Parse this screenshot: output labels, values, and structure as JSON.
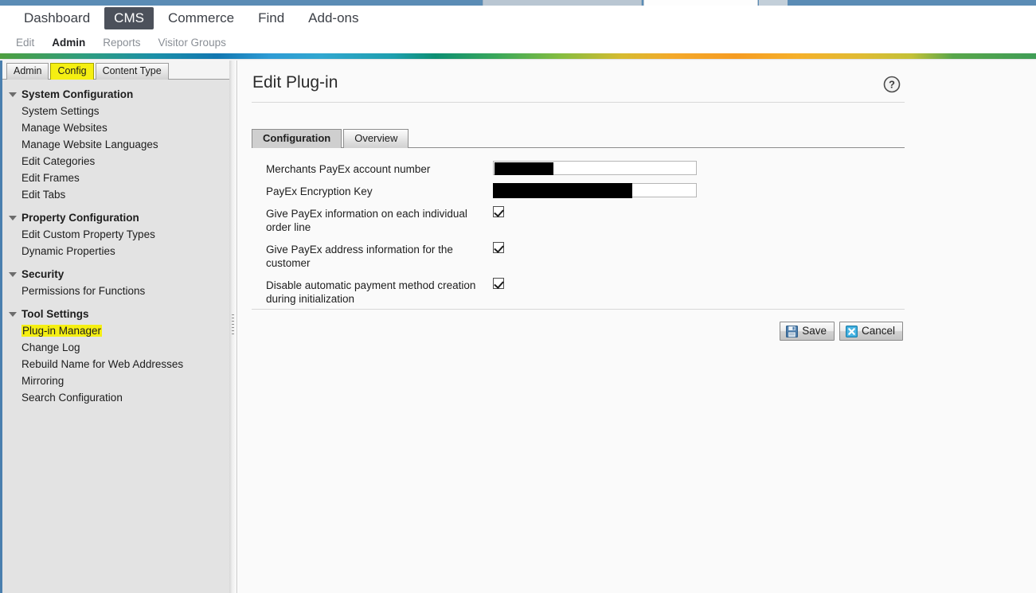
{
  "browser": {
    "tab_label": "",
    "note": ""
  },
  "topnav": {
    "items": [
      {
        "label": "Dashboard",
        "active": false
      },
      {
        "label": "CMS",
        "active": true
      },
      {
        "label": "Commerce",
        "active": false
      },
      {
        "label": "Find",
        "active": false
      },
      {
        "label": "Add-ons",
        "active": false
      }
    ],
    "active_color": "#4c515b"
  },
  "subnav": {
    "items": [
      {
        "label": "Edit",
        "active": false
      },
      {
        "label": "Admin",
        "active": true
      },
      {
        "label": "Reports",
        "active": false
      },
      {
        "label": "Visitor Groups",
        "active": false
      }
    ]
  },
  "sidebar": {
    "tabs": [
      {
        "label": "Admin",
        "highlighted": false
      },
      {
        "label": "Config",
        "highlighted": true
      },
      {
        "label": "Content Type",
        "highlighted": false
      }
    ],
    "highlight_color": "#f5ef12",
    "groups": [
      {
        "label": "System Configuration",
        "items": [
          {
            "label": "System Settings",
            "highlighted": false
          },
          {
            "label": "Manage Websites",
            "highlighted": false
          },
          {
            "label": "Manage Website Languages",
            "highlighted": false
          },
          {
            "label": "Edit Categories",
            "highlighted": false
          },
          {
            "label": "Edit Frames",
            "highlighted": false
          },
          {
            "label": "Edit Tabs",
            "highlighted": false
          }
        ]
      },
      {
        "label": "Property Configuration",
        "items": [
          {
            "label": "Edit Custom Property Types",
            "highlighted": false
          },
          {
            "label": "Dynamic Properties",
            "highlighted": false
          }
        ]
      },
      {
        "label": "Security",
        "items": [
          {
            "label": "Permissions for Functions",
            "highlighted": false
          }
        ]
      },
      {
        "label": "Tool Settings",
        "items": [
          {
            "label": "Plug-in Manager",
            "highlighted": true
          },
          {
            "label": "Change Log",
            "highlighted": false
          },
          {
            "label": "Rebuild Name for Web Addresses",
            "highlighted": false
          },
          {
            "label": "Mirroring",
            "highlighted": false
          },
          {
            "label": "Search Configuration",
            "highlighted": false
          }
        ]
      }
    ]
  },
  "main": {
    "title": "Edit Plug-in",
    "help_icon": "question-mark-circle-icon",
    "tabs": [
      {
        "label": "Configuration",
        "active": true
      },
      {
        "label": "Overview",
        "active": false
      }
    ],
    "fields": [
      {
        "label": "Merchants PayEx account number",
        "type": "text",
        "value": "",
        "redacted": true,
        "redaction": "a"
      },
      {
        "label": "PayEx Encryption Key",
        "type": "text",
        "value": "",
        "redacted": true,
        "redaction": "b"
      },
      {
        "label": "Give PayEx information on each individual order line",
        "type": "checkbox",
        "checked": true
      },
      {
        "label": "Give PayEx address information for the customer",
        "type": "checkbox",
        "checked": true
      },
      {
        "label": "Disable automatic payment method creation during initialization",
        "type": "checkbox",
        "checked": true
      }
    ],
    "buttons": [
      {
        "label": "Save",
        "icon": "floppy-disk-icon"
      },
      {
        "label": "Cancel",
        "icon": "blue-x-icon"
      }
    ]
  }
}
